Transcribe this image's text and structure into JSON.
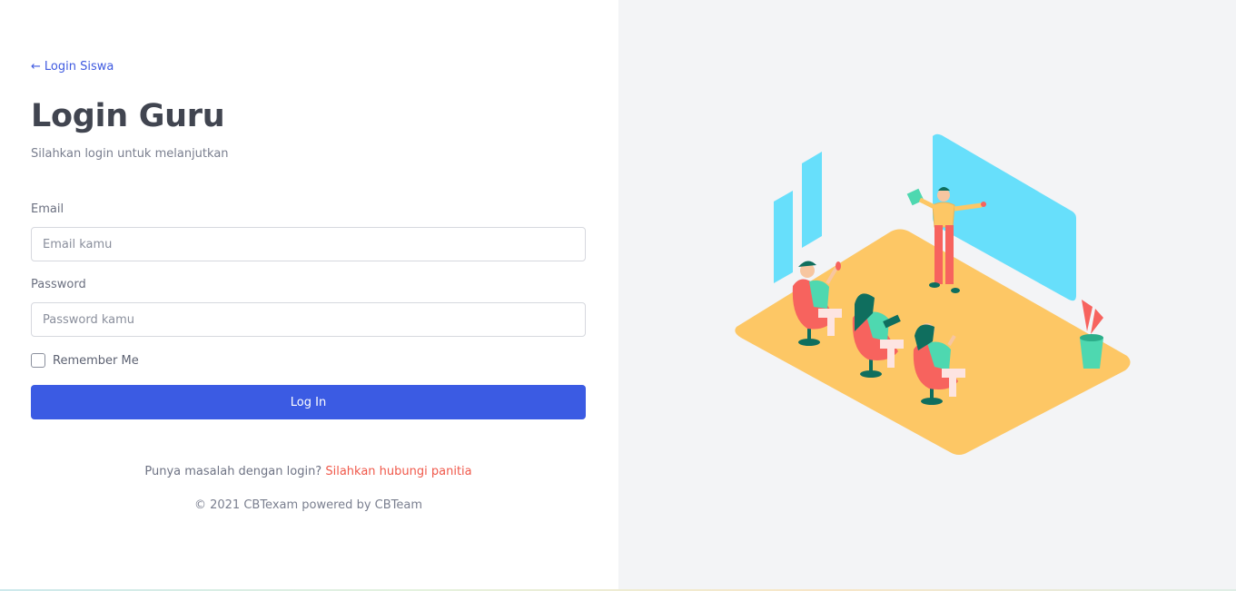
{
  "back_link": {
    "label": "Login Siswa"
  },
  "page": {
    "title": "Login Guru",
    "subtitle": "Silahkan login untuk melanjutkan"
  },
  "form": {
    "email_label": "Email",
    "email_placeholder": "Email kamu",
    "password_label": "Password",
    "password_placeholder": "Password kamu",
    "remember_label": "Remember Me",
    "login_button": "Log In"
  },
  "help": {
    "question": "Punya masalah dengan login?",
    "contact_link": "Silahkan hubungi panitia"
  },
  "footer": {
    "copyright": "© 2021 CBTexam powered by CBTeam"
  },
  "colors": {
    "primary": "#3b5be3",
    "accent_link": "#f0594b",
    "right_bg": "#f3f4f6",
    "floor": "#fdc765",
    "board": "#67dffb"
  },
  "illustration": {
    "icon": "classroom-illustration"
  }
}
